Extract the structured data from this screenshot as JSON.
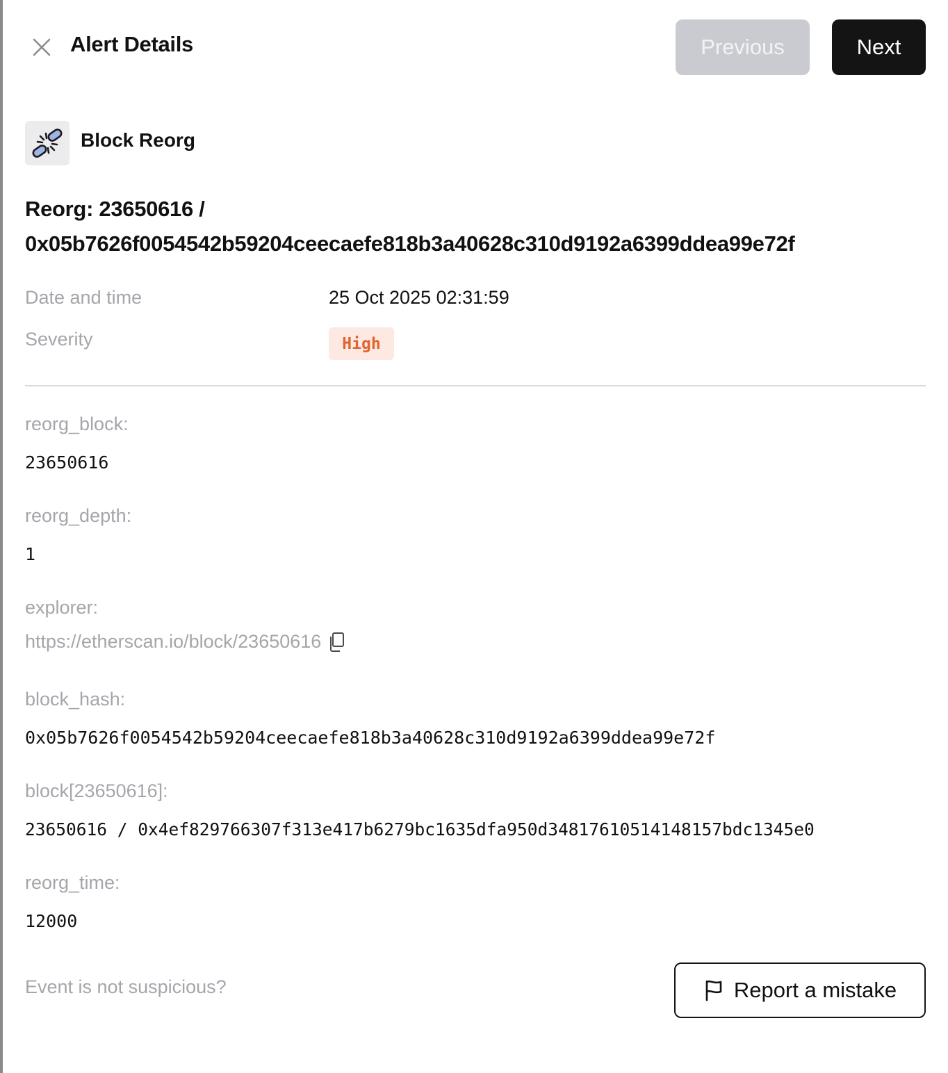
{
  "header": {
    "title": "Alert Details",
    "previous_label": "Previous",
    "next_label": "Next"
  },
  "alert": {
    "type": "Block Reorg",
    "title_line1": "Reorg: 23650616 /",
    "title_line2": "0x05b7626f0054542b59204ceecaefe818b3a40628c310d9192a6399ddea99e72f"
  },
  "meta": {
    "date_label": "Date and time",
    "date_value": "25 Oct 2025 02:31:59",
    "severity_label": "Severity",
    "severity_value": "High",
    "severity_color": "#e0642f",
    "severity_bg": "#fde8e2"
  },
  "fields": {
    "reorg_block_label": "reorg_block:",
    "reorg_block_value": "23650616",
    "reorg_depth_label": "reorg_depth:",
    "reorg_depth_value": "1",
    "explorer_label": "explorer:",
    "explorer_value": "https://etherscan.io/block/23650616",
    "block_hash_label": "block_hash:",
    "block_hash_value": "0x05b7626f0054542b59204ceecaefe818b3a40628c310d9192a6399ddea99e72f",
    "block_n_label": "block[23650616]:",
    "block_n_value": "23650616 / 0x4ef829766307f313e417b6279bc1635dfa950d34817610514148157bdc1345e0",
    "reorg_time_label": "reorg_time:",
    "reorg_time_value": "12000"
  },
  "footer": {
    "question": "Event is not suspicious?",
    "report_label": "Report a mistake"
  },
  "icons": {
    "close": "close-icon",
    "type": "broken-chain-icon",
    "copy": "copy-icon",
    "report": "flag-icon"
  }
}
